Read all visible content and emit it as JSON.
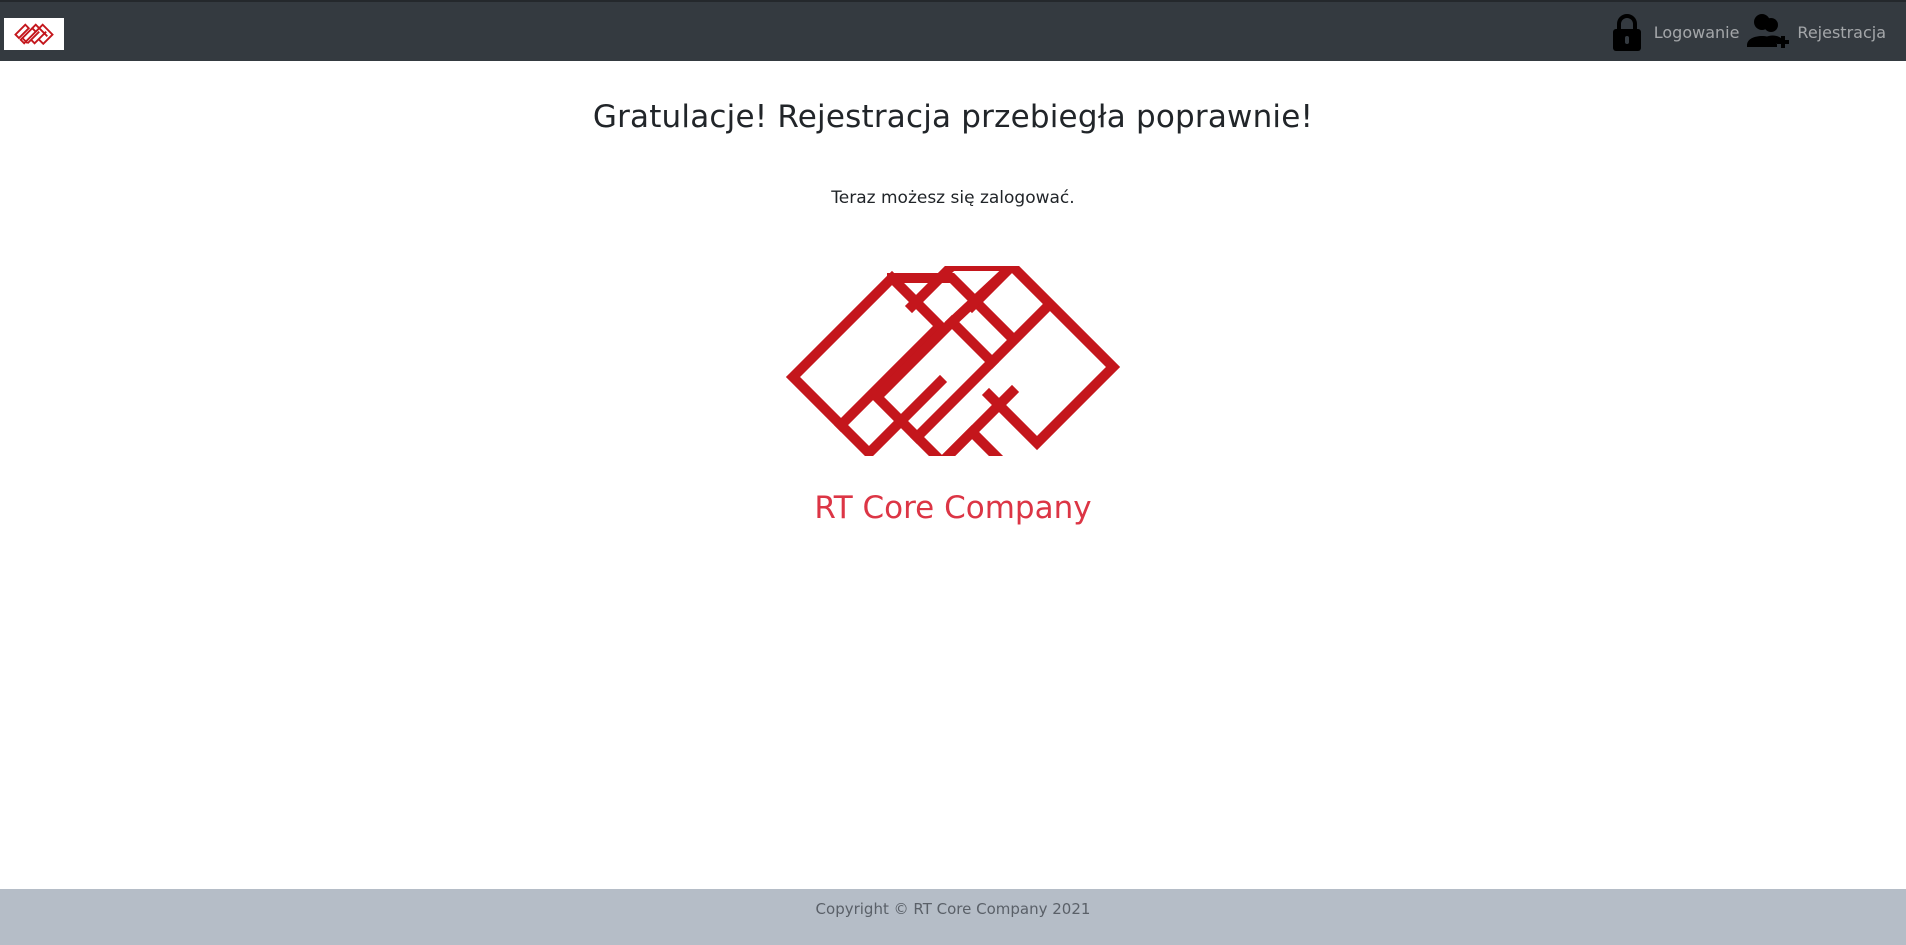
{
  "navbar": {
    "brand_icon": "company-logo",
    "links": [
      {
        "label": "Logowanie",
        "icon": "lock-icon"
      },
      {
        "label": "Rejestracja",
        "icon": "user-plus-icon"
      }
    ]
  },
  "main": {
    "title": "Gratulacje! Rejestracja przebiegła poprawnie!",
    "subtitle": "Teraz możesz się zalogować.",
    "company_name": "RT Core Company"
  },
  "footer": {
    "copyright": "Copyright © RT Core Company 2021"
  },
  "colors": {
    "navbar_bg": "#343a40",
    "brand_red": "#c4161c",
    "company_text": "#dc3545",
    "footer_bg": "#b5bdc7"
  }
}
